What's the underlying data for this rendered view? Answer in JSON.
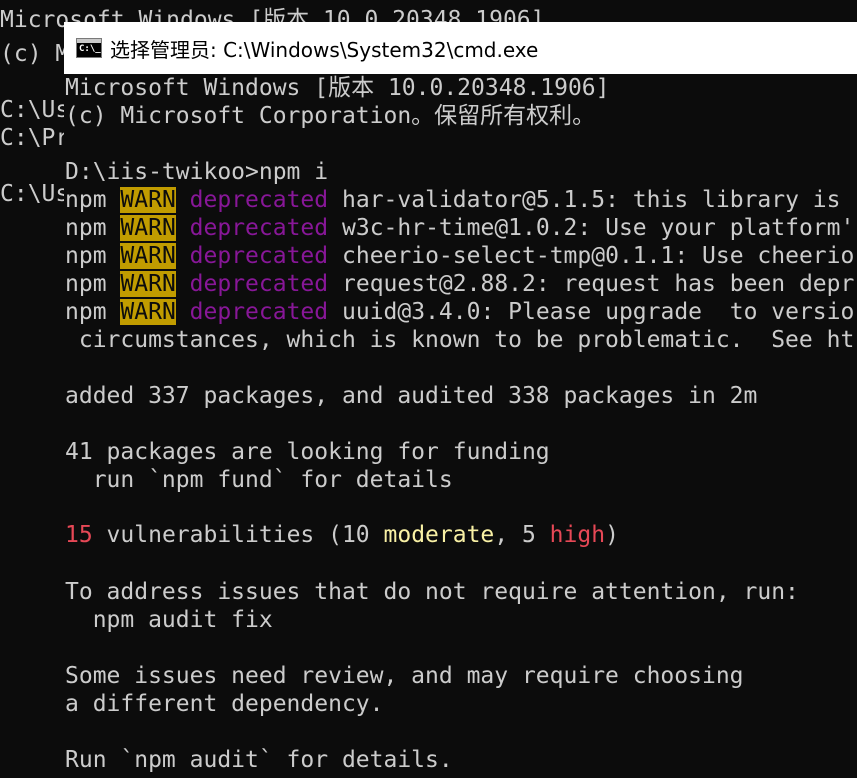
{
  "background_window": {
    "lines": [
      "Microsoft Windows [版本 10.0.20348.1906]",
      "(c) M",
      "",
      "C:\\Us",
      "C:\\Pr",
      "",
      "C:\\Us"
    ]
  },
  "window": {
    "title": "选择管理员: C:\\Windows\\System32\\cmd.exe",
    "icon": "cmd-icon",
    "icon_glyph": "C:\\_"
  },
  "console": {
    "header_version": "Microsoft Windows [版本 10.0.20348.1906]",
    "header_copyright": "(c) Microsoft Corporation。保留所有权利。",
    "prompt": "D:\\iis-twikoo>npm i",
    "warnings": [
      {
        "prefix": "npm",
        "level": "WARN",
        "tag": "deprecated",
        "message": "har-validator@5.1.5: this library is"
      },
      {
        "prefix": "npm",
        "level": "WARN",
        "tag": "deprecated",
        "message": "w3c-hr-time@1.0.2: Use your platform'"
      },
      {
        "prefix": "npm",
        "level": "WARN",
        "tag": "deprecated",
        "message": "cheerio-select-tmp@0.1.1: Use cheerio"
      },
      {
        "prefix": "npm",
        "level": "WARN",
        "tag": "deprecated",
        "message": "request@2.88.2: request has been depr"
      },
      {
        "prefix": "npm",
        "level": "WARN",
        "tag": "deprecated",
        "message": "uuid@3.4.0: Please upgrade  to versio"
      }
    ],
    "warning_continuation": " circumstances, which is known to be problematic.  See ht",
    "added_line": "added 337 packages, and audited 338 packages in 2m",
    "funding_line1": "41 packages are looking for funding",
    "funding_line2": "  run `npm fund` for details",
    "vuln": {
      "count": "15",
      "text_a": " vulnerabilities (10 ",
      "moderate": "moderate",
      "text_b": ", 5 ",
      "high": "high",
      "text_c": ")"
    },
    "address_line1": "To address issues that do not require attention, run:",
    "address_line2": "  npm audit fix",
    "review_line1": "Some issues need review, and may require choosing",
    "review_line2": "a different dependency.",
    "run_line": "Run `npm audit` for details."
  },
  "colors": {
    "console_bg": "#0c0c0c",
    "console_fg": "#cccccc",
    "warn_bg": "#c19c00",
    "deprecated": "#881798",
    "vuln_red": "#e74856",
    "moderate_yellow": "#f9f1a5",
    "titlebar_bg": "#ffffff"
  }
}
